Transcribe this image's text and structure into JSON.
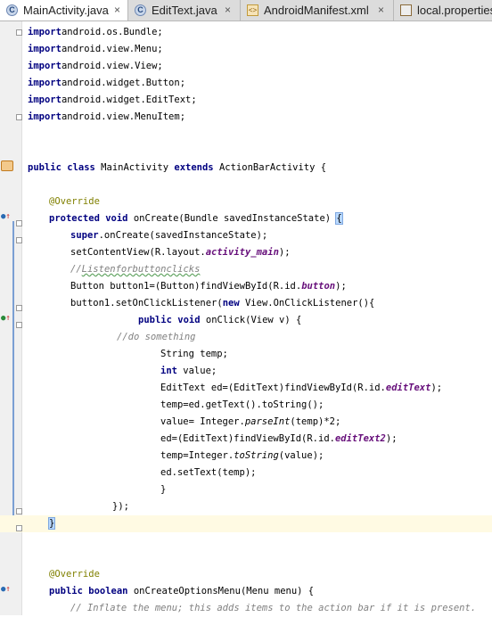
{
  "tabs": [
    {
      "label": "MainActivity.java",
      "icon": "java-class-icon",
      "close": "×",
      "active": true
    },
    {
      "label": "EditText.java",
      "icon": "java-class-g-icon",
      "close": "×",
      "active": false
    },
    {
      "label": "AndroidManifest.xml",
      "icon": "xml-file-icon",
      "close": "×",
      "active": false
    },
    {
      "label": "local.properties",
      "icon": "properties-file-icon",
      "close": "",
      "active": false
    }
  ],
  "code": [
    [
      [
        "kw",
        "import"
      ],
      [
        "",
        "android.os.Bundle;"
      ]
    ],
    [
      [
        "kw",
        "import"
      ],
      [
        "",
        "android.view.Menu;"
      ]
    ],
    [
      [
        "kw",
        "import"
      ],
      [
        "",
        "android.view.View;"
      ]
    ],
    [
      [
        "kw",
        "import"
      ],
      [
        "",
        "android.widget.Button;"
      ]
    ],
    [
      [
        "kw",
        "import"
      ],
      [
        "",
        "android.widget.EditText;"
      ]
    ],
    [
      [
        "kw",
        "import"
      ],
      [
        "",
        "android.view.MenuItem;"
      ]
    ],
    [],
    [],
    [
      [
        "kw",
        "public class"
      ],
      [
        "",
        " MainActivity "
      ],
      [
        "kw",
        "extends"
      ],
      [
        "",
        " ActionBarActivity {"
      ]
    ],
    [],
    [
      [
        "",
        ""
      ],
      [
        "ann",
        "@Override"
      ]
    ],
    [
      [
        "kw",
        "protected void"
      ],
      [
        "",
        " onCreate(Bundle savedInstanceState) "
      ],
      [
        "brmatch",
        "{"
      ]
    ],
    [
      [
        "kw",
        "super"
      ],
      [
        "",
        ".onCreate(savedInstanceState);"
      ]
    ],
    [
      [
        "",
        "setContentView(R.layout."
      ],
      [
        "field",
        "activity_main"
      ],
      [
        "",
        ");"
      ]
    ],
    [
      [
        "cmt",
        "//"
      ],
      [
        "cmt typo",
        "Listenforbuttonclicks"
      ]
    ],
    [
      [
        "",
        "Button button1=(Button)findViewById(R.id."
      ],
      [
        "field",
        "button"
      ],
      [
        "",
        ");"
      ]
    ],
    [
      [
        "",
        "button1.setOnClickListener("
      ],
      [
        "kw",
        "new"
      ],
      [
        "",
        " View.OnClickListener(){"
      ]
    ],
    [
      [
        "kw",
        "public void"
      ],
      [
        "",
        " onClick(View v) {"
      ]
    ],
    [
      [
        "cmt",
        "//do something"
      ]
    ],
    [
      [
        "",
        "String temp;"
      ]
    ],
    [
      [
        "kw",
        "int"
      ],
      [
        "",
        " value;"
      ]
    ],
    [
      [
        "",
        "EditText ed=(EditText)findViewById(R.id."
      ],
      [
        "field",
        "editText"
      ],
      [
        "",
        ");"
      ]
    ],
    [
      [
        "",
        "temp=ed.getText().toString();"
      ]
    ],
    [
      [
        "",
        "value= Integer."
      ],
      [
        "smeth",
        "parseInt"
      ],
      [
        "",
        "(temp)*2;"
      ]
    ],
    [
      [
        "",
        "ed=(EditText)findViewById(R.id."
      ],
      [
        "field",
        "editText2"
      ],
      [
        "",
        ");"
      ]
    ],
    [
      [
        "",
        "temp=Integer."
      ],
      [
        "smeth",
        "toString"
      ],
      [
        "",
        "(value);"
      ]
    ],
    [
      [
        "",
        "ed.setText(temp);"
      ]
    ],
    [
      [
        "",
        "}"
      ]
    ],
    [
      [
        "",
        "});"
      ]
    ],
    [
      [
        "brmatch",
        "}"
      ],
      [
        "caret",
        ""
      ]
    ],
    [],
    [],
    [
      [
        "ann",
        "@Override"
      ]
    ],
    [
      [
        "kw",
        "public boolean"
      ],
      [
        "",
        " onCreateOptionsMenu(Menu menu) {"
      ]
    ],
    [
      [
        "cmt",
        "// Inflate the menu; this adds items to the action bar if it is present."
      ]
    ]
  ]
}
